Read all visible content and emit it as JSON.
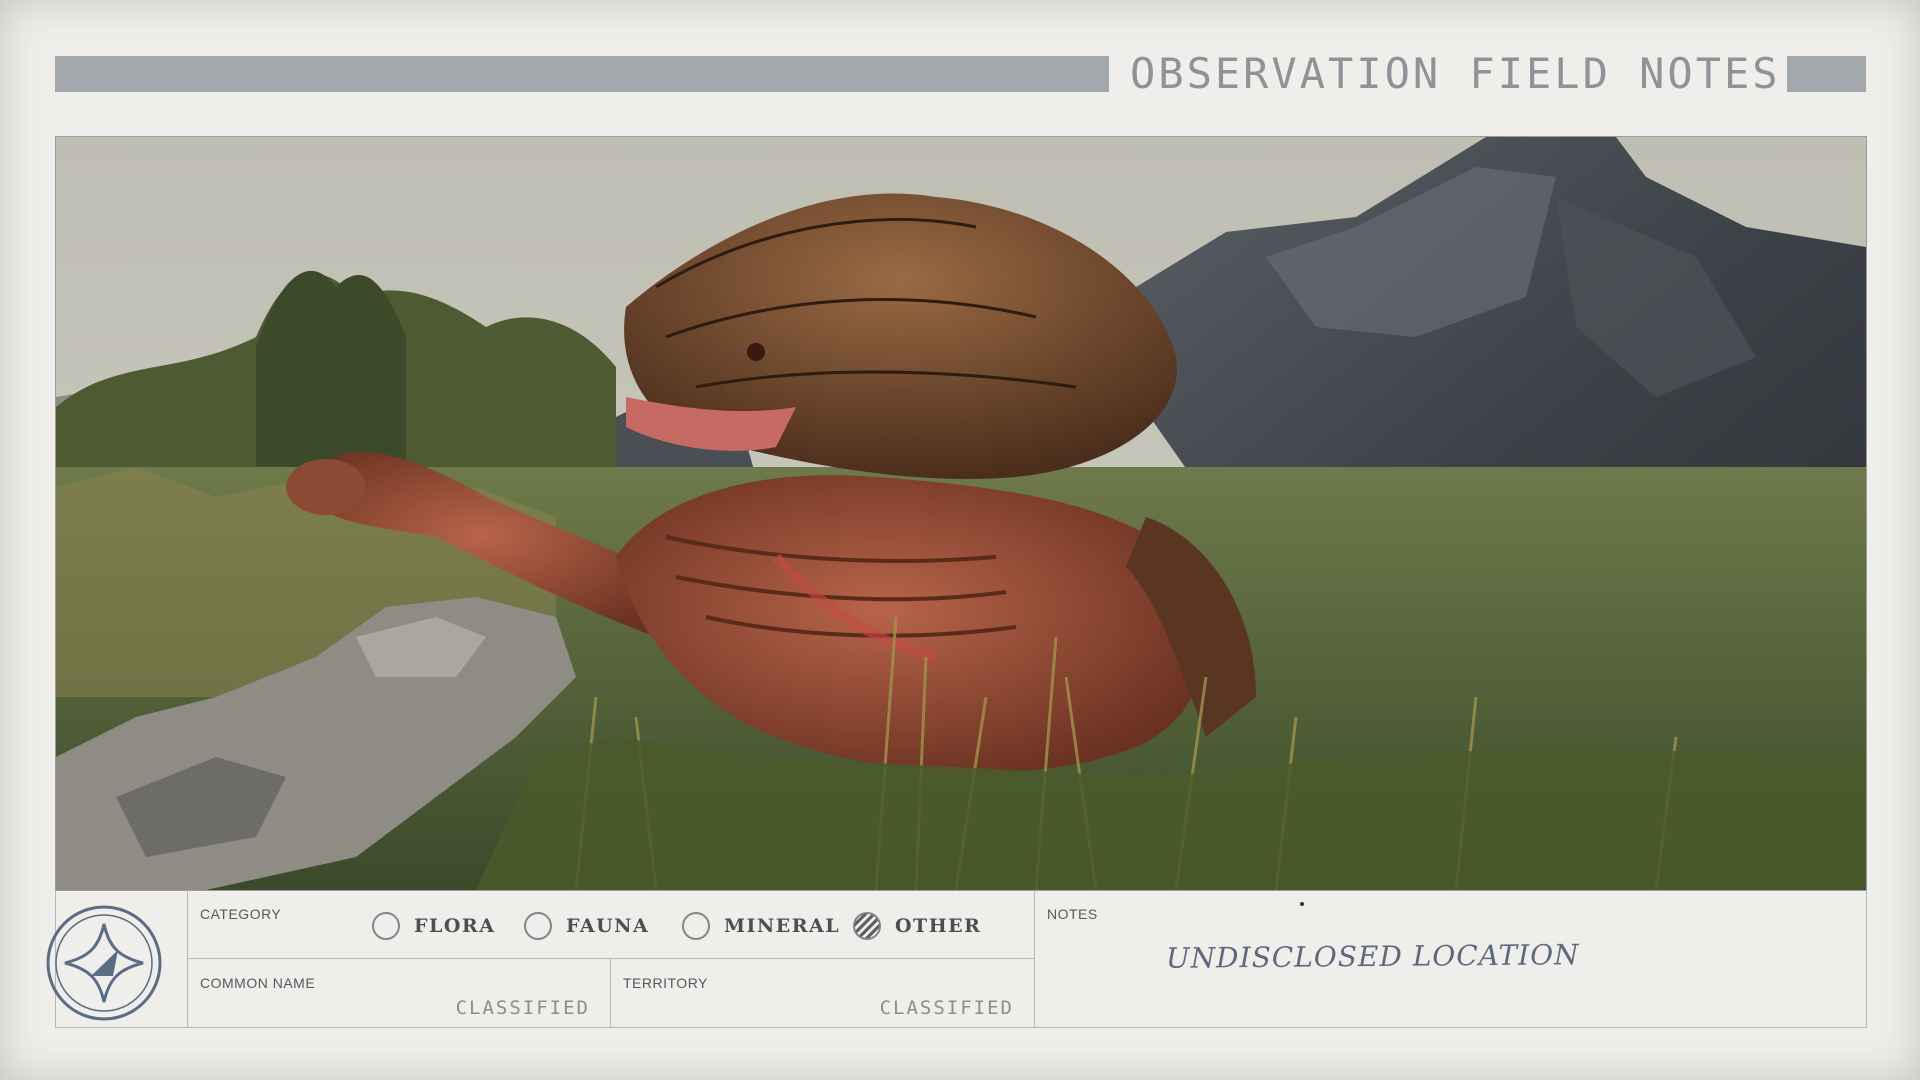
{
  "header": {
    "title": "OBSERVATION FIELD NOTES"
  },
  "photo": {
    "subject": "creature-photo"
  },
  "form": {
    "category_label": "CATEGORY",
    "options": [
      {
        "label": "FLORA",
        "selected": false
      },
      {
        "label": "FAUNA",
        "selected": false
      },
      {
        "label": "MINERAL",
        "selected": false
      },
      {
        "label": "OTHER",
        "selected": true
      }
    ],
    "common_name_label": "COMMON NAME",
    "common_name_value": "CLASSIFIED",
    "territory_label": "TERRITORY",
    "territory_value": "CLASSIFIED",
    "notes_label": "NOTES",
    "notes_value": "UNDISCLOSED LOCATION"
  },
  "colors": {
    "paper": "#efeeea",
    "bar": "#a3a8ac",
    "ink": "#5d6a7e"
  }
}
